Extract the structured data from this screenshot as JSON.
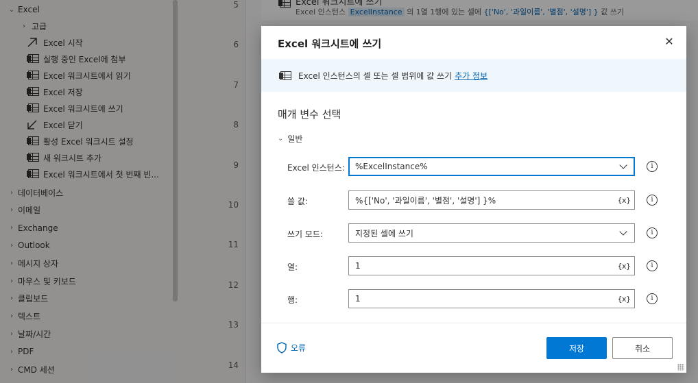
{
  "sidebar": {
    "groups_top": [
      {
        "label": "Excel"
      }
    ],
    "excel_children": [
      {
        "type": "sub",
        "label": "고급"
      },
      {
        "type": "action",
        "icon": "arrow-up-right-icon",
        "label": "Excel 시작"
      },
      {
        "type": "action",
        "icon": "table-icon",
        "label": "실행 중인 Excel에 첨부"
      },
      {
        "type": "action",
        "icon": "table-icon",
        "label": "Excel 워크시트에서 읽기"
      },
      {
        "type": "action",
        "icon": "table-icon",
        "label": "Excel 저장"
      },
      {
        "type": "action",
        "icon": "table-icon",
        "label": "Excel 워크시트에 쓰기"
      },
      {
        "type": "action",
        "icon": "arrow-down-left-icon",
        "label": "Excel 닫기"
      },
      {
        "type": "action",
        "icon": "table-icon",
        "label": "활성 Excel 워크시트 설정"
      },
      {
        "type": "action",
        "icon": "table-icon",
        "label": "새 워크시트 추가"
      },
      {
        "type": "action",
        "icon": "table-icon",
        "label": "Excel 워크시트에서 첫 번째 빈..."
      }
    ],
    "groups": [
      {
        "label": "데이터베이스"
      },
      {
        "label": "이메일"
      },
      {
        "label": "Exchange"
      },
      {
        "label": "Outlook"
      },
      {
        "label": "메시지 상자"
      },
      {
        "label": "마우스 및 키보드"
      },
      {
        "label": "클립보드"
      },
      {
        "label": "텍스트"
      },
      {
        "label": "날짜/시간"
      },
      {
        "label": "PDF"
      },
      {
        "label": "CMD 세션"
      }
    ]
  },
  "flow": {
    "line_numbers": [
      "5",
      "6",
      "7",
      "8",
      "9",
      "10",
      "11",
      "12",
      "13",
      "14"
    ],
    "step5": {
      "title": "Excel 워크시트에 쓰기",
      "desc_prefix": "Excel 인스턴스",
      "instance_token": "ExcelInstance",
      "desc_mid": "의 1열 1행에 있는 셀에",
      "value_token": "{['No', '과일이름', '별점', '설명'] }",
      "desc_suffix": "값 쓰기"
    }
  },
  "dialog": {
    "title": "Excel 워크시트에 쓰기",
    "close_glyph": "✕",
    "info_text": "Excel 인스턴스의 셀 또는 셀 범위에 값 쓰기",
    "info_link": "추가 정보",
    "param_title": "매개 변수 선택",
    "section_general": "일반",
    "fields": {
      "instance": {
        "label": "Excel 인스턴스:",
        "value": "%ExcelInstance%"
      },
      "value": {
        "label": "쓸 값:",
        "value": "%{['No', '과일이름', '별점', '설명'] }%",
        "var_glyph": "{x}"
      },
      "mode": {
        "label": "쓰기 모드:",
        "value": "지정된 셀에 쓰기"
      },
      "column": {
        "label": "열:",
        "value": "1",
        "var_glyph": "{x}"
      },
      "row": {
        "label": "행:",
        "value": "1",
        "var_glyph": "{x}"
      }
    },
    "info_glyph": "i",
    "error_label": "오류",
    "save_label": "저장",
    "cancel_label": "취소"
  },
  "colors": {
    "accent": "#0078d4",
    "link": "#0063b1",
    "info_bar": "#eff6fc"
  }
}
